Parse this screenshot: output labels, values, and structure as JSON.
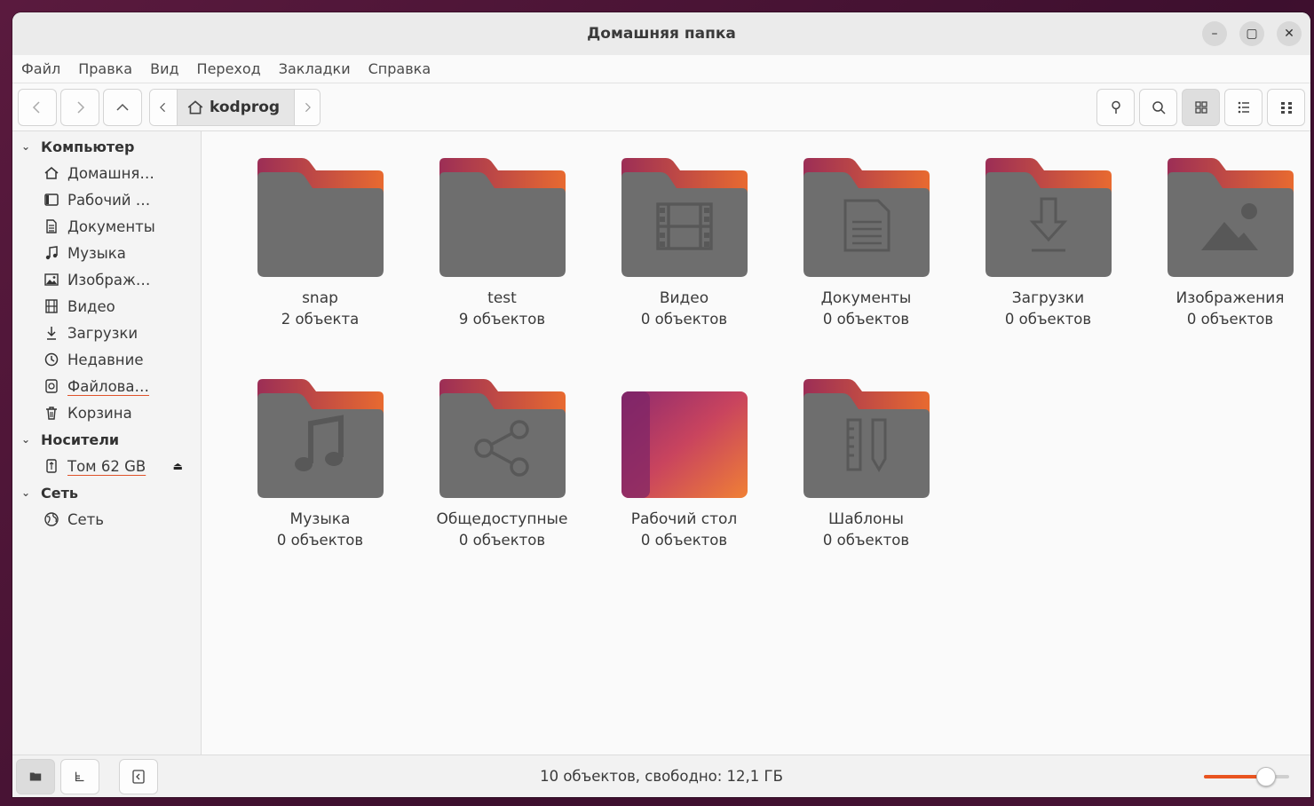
{
  "window": {
    "title": "Домашняя папка"
  },
  "menubar": {
    "items": [
      "Файл",
      "Правка",
      "Вид",
      "Переход",
      "Закладки",
      "Справка"
    ]
  },
  "pathbar": {
    "current": "kodprog"
  },
  "sidebar": {
    "sections": [
      {
        "label": "Компьютер",
        "items": [
          {
            "label": "Домашня…",
            "icon": "home-icon"
          },
          {
            "label": "Рабочий …",
            "icon": "desktop-icon"
          },
          {
            "label": "Документы",
            "icon": "document-icon"
          },
          {
            "label": "Музыка",
            "icon": "music-icon"
          },
          {
            "label": "Изображ…",
            "icon": "image-icon"
          },
          {
            "label": "Видео",
            "icon": "video-icon"
          },
          {
            "label": "Загрузки",
            "icon": "download-icon"
          },
          {
            "label": "Недавние",
            "icon": "recent-icon"
          },
          {
            "label": "Файлова…",
            "icon": "filesystem-icon"
          },
          {
            "label": "Корзина",
            "icon": "trash-icon"
          }
        ]
      },
      {
        "label": "Носители",
        "items": [
          {
            "label": "Том 62 GB",
            "icon": "usb-drive-icon"
          }
        ]
      },
      {
        "label": "Сеть",
        "items": [
          {
            "label": "Сеть",
            "icon": "network-icon"
          }
        ]
      }
    ]
  },
  "files": [
    {
      "name": "snap",
      "count": "2 объекта",
      "emblem": "none"
    },
    {
      "name": "test",
      "count": "9 объектов",
      "emblem": "none"
    },
    {
      "name": "Видео",
      "count": "0 объектов",
      "emblem": "video"
    },
    {
      "name": "Документы",
      "count": "0 объектов",
      "emblem": "document"
    },
    {
      "name": "Загрузки",
      "count": "0 объектов",
      "emblem": "download"
    },
    {
      "name": "Изображения",
      "count": "0 объектов",
      "emblem": "image"
    },
    {
      "name": "Музыка",
      "count": "0 объектов",
      "emblem": "music"
    },
    {
      "name": "Общедоступные",
      "count": "0 объектов",
      "emblem": "share"
    },
    {
      "name": "Рабочий стол",
      "count": "0 объектов",
      "emblem": "desktop"
    },
    {
      "name": "Шаблоны",
      "count": "0 объектов",
      "emblem": "templates"
    }
  ],
  "statusbar": {
    "text": "10 объектов, свободно: 12,1 ГБ",
    "zoom_level": 0.8
  },
  "colors": {
    "accent": "#e95420",
    "folder_body": "#6e6e6e",
    "folder_tab": "#a23a58"
  }
}
